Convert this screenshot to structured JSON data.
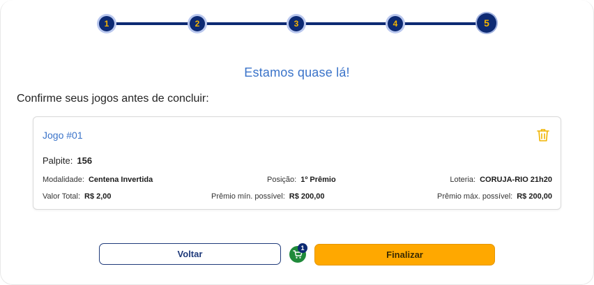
{
  "stepper": {
    "steps": [
      "1",
      "2",
      "3",
      "4",
      "5"
    ],
    "active": 5
  },
  "headline": "Estamos quase lá!",
  "subtitle": "Confirme seus jogos antes de concluir:",
  "card": {
    "title": "Jogo #01",
    "palpite_label": "Palpite:",
    "palpite_value": "156",
    "modalidade_label": "Modalidade:",
    "modalidade_value": "Centena Invertida",
    "posicao_label": "Posição:",
    "posicao_value": "1º Prêmio",
    "loteria_label": "Loteria:",
    "loteria_value": "CORUJA-RIO 21h20",
    "valor_label": "Valor Total:",
    "valor_value": "R$ 2,00",
    "premio_min_label": "Prêmio mín. possível:",
    "premio_min_value": "R$ 200,00",
    "premio_max_label": "Prêmio máx. possível:",
    "premio_max_value": "R$ 200,00",
    "delete_icon": "trash-icon"
  },
  "actions": {
    "back_label": "Voltar",
    "finish_label": "Finalizar",
    "cart_count": "1",
    "cart_icon": "cart-icon"
  },
  "colors": {
    "primary_navy": "#0d2a73",
    "accent_blue": "#3a73c9",
    "accent_orange": "#ffa800",
    "step_number": "#f5b400",
    "cart_green": "#1f8a3a"
  }
}
